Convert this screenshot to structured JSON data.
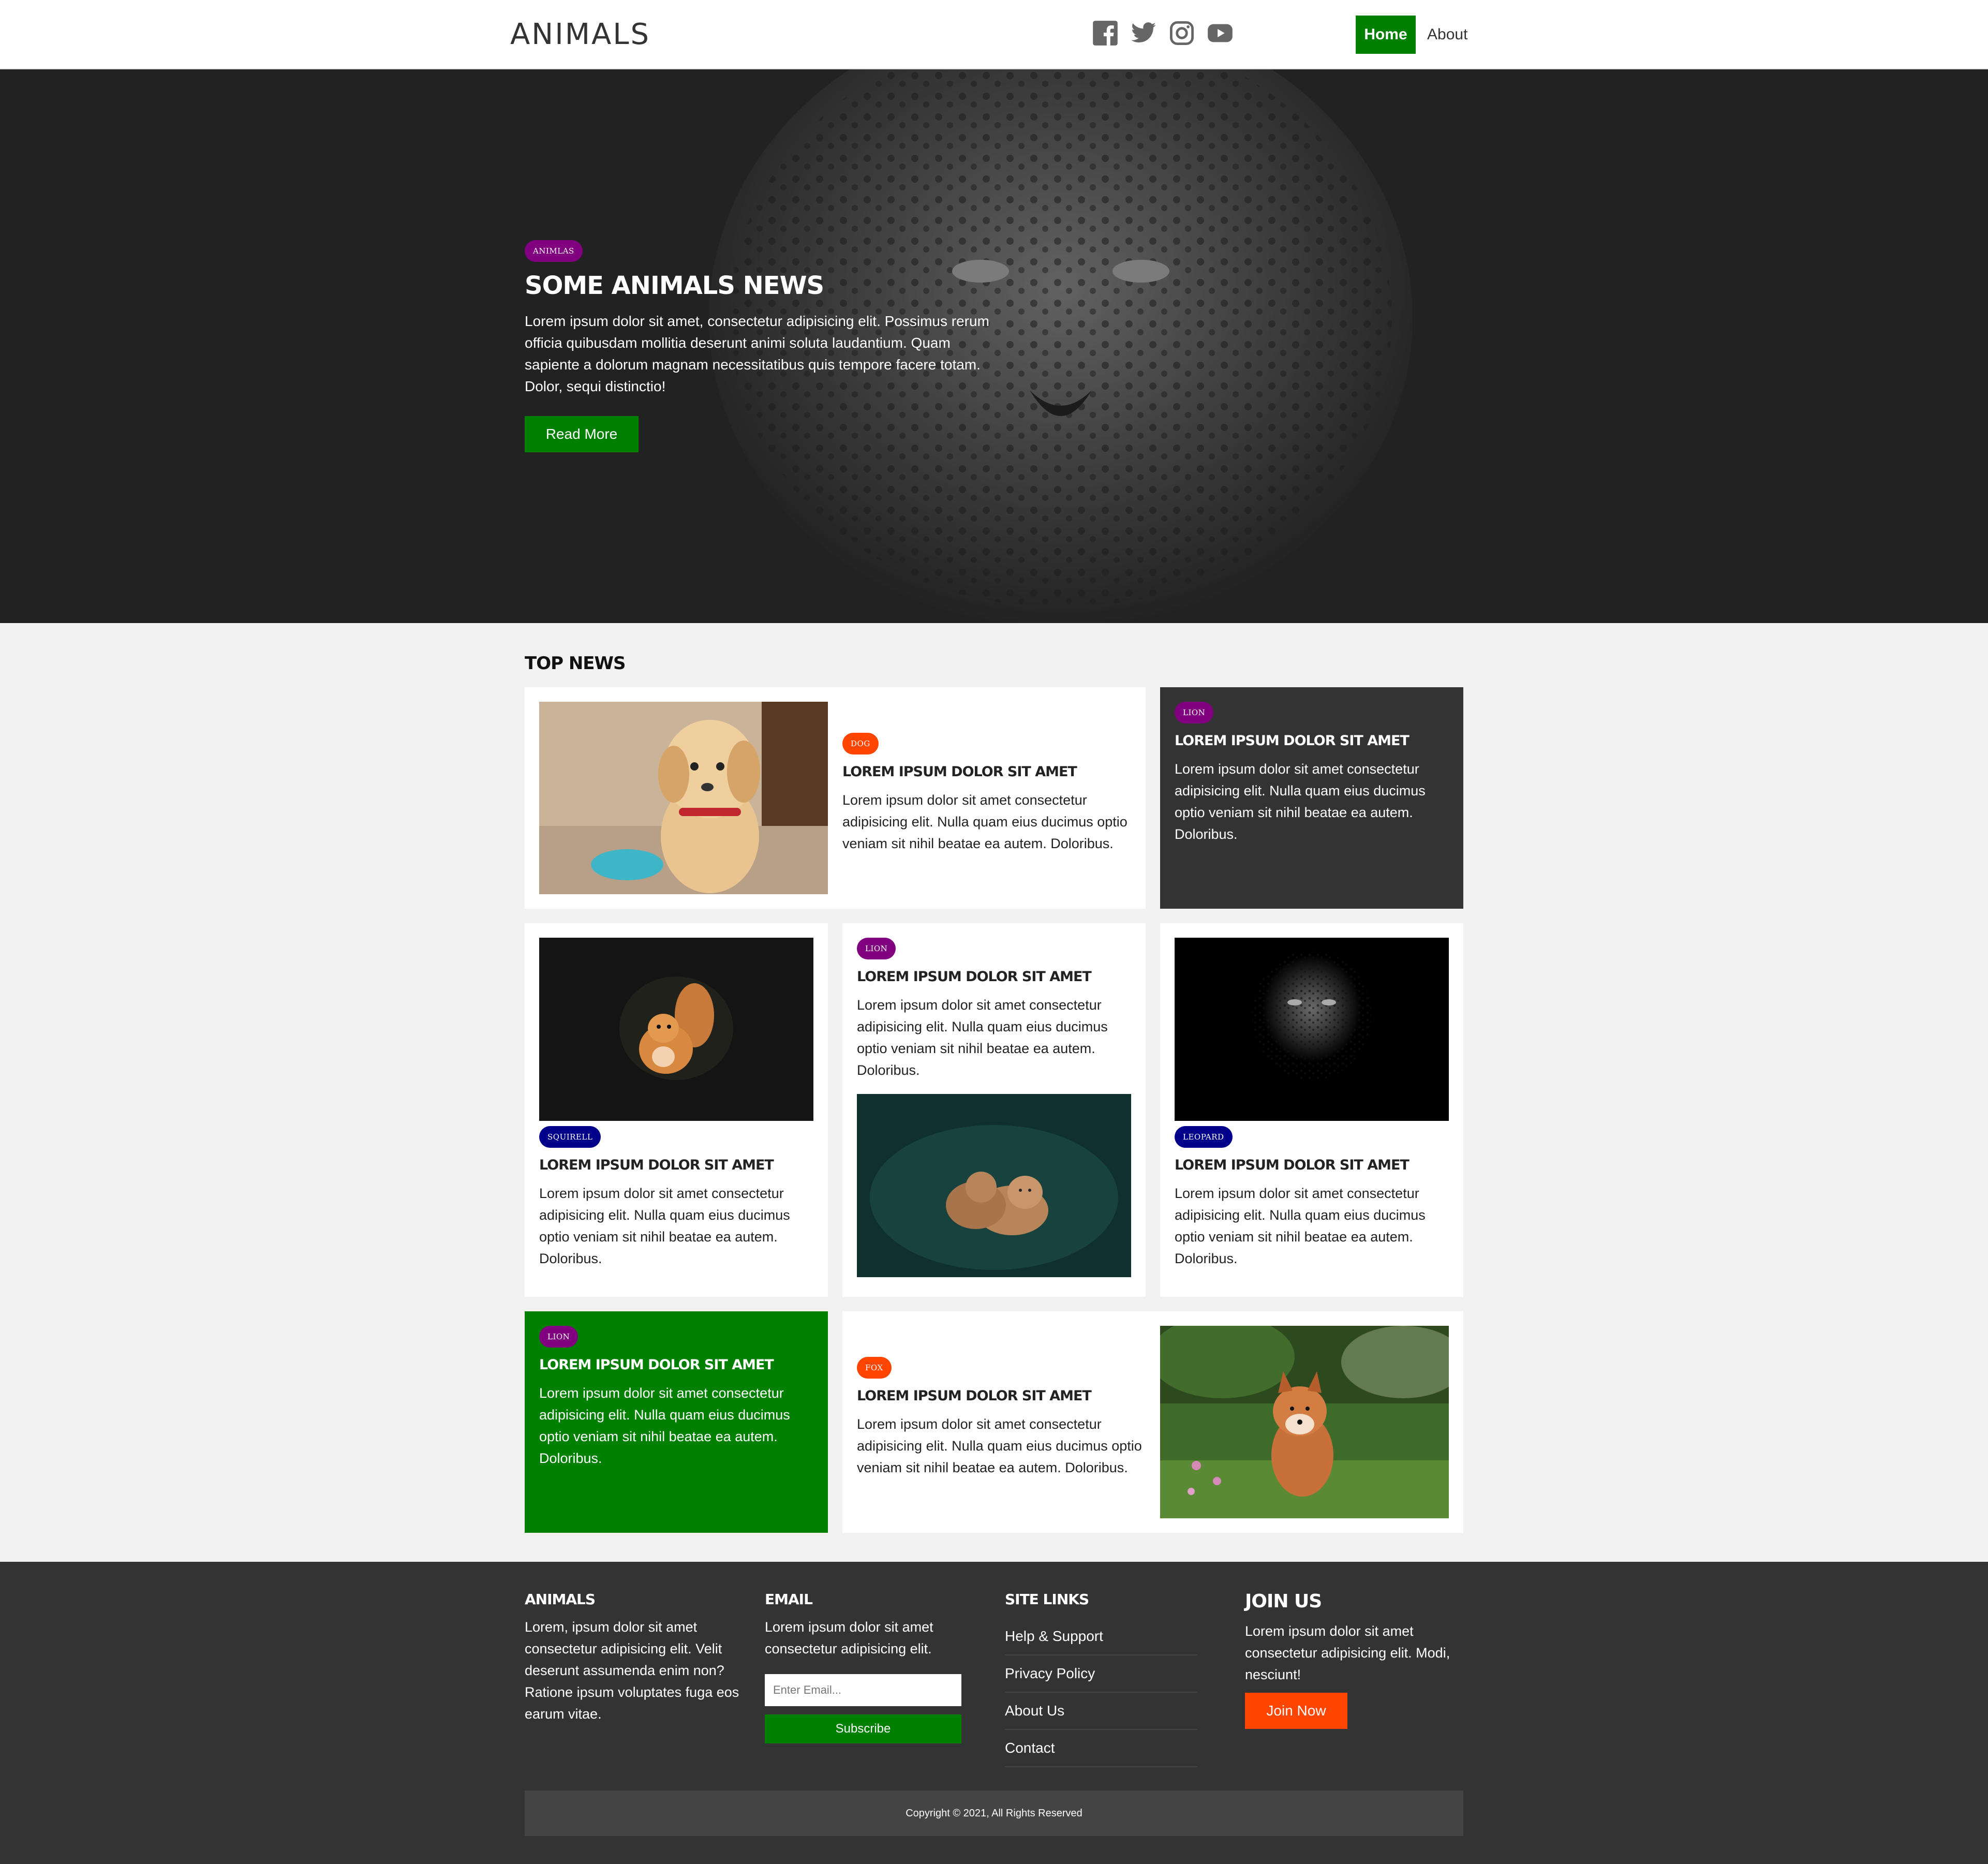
{
  "header": {
    "logo": "ANIMALS",
    "social_icons": [
      "facebook-icon",
      "twitter-icon",
      "instagram-icon",
      "youtube-icon"
    ],
    "nav": {
      "home": "Home",
      "about": "About"
    }
  },
  "hero": {
    "badge": "ANIMLAS",
    "title": "SOME ANIMALS NEWS",
    "text": "Lorem ipsum dolor sit amet, consectetur adipisicing elit. Possimus rerum officia quibusdam mollitia deserunt animi soluta laudantium. Quam sapiente a dolorum magnam necessitatibus quis tempore facere totam. Dolor, sequi distinctio!",
    "button": "Read More"
  },
  "top_news": {
    "title": "TOP NEWS",
    "cards": [
      {
        "badge": "DOG",
        "title": "LOREM IPSUM DOLOR SIT AMET",
        "text": "Lorem ipsum dolor sit amet consectetur adipisicing elit. Nulla quam eius ducimus optio veniam sit nihil beatae ea autem. Doloribus."
      },
      {
        "badge": "LION",
        "title": "LOREM IPSUM DOLOR SIT AMET",
        "text": "Lorem ipsum dolor sit amet consectetur adipisicing elit. Nulla quam eius ducimus optio veniam sit nihil beatae ea autem. Doloribus."
      },
      {
        "badge": "SQUIRELL",
        "title": "LOREM IPSUM DOLOR SIT AMET",
        "text": "Lorem ipsum dolor sit amet consectetur adipisicing elit. Nulla quam eius ducimus optio veniam sit nihil beatae ea autem. Doloribus."
      },
      {
        "badge": "LION",
        "title": "LOREM IPSUM DOLOR SIT AMET",
        "text": "Lorem ipsum dolor sit amet consectetur adipisicing elit. Nulla quam eius ducimus optio veniam sit nihil beatae ea autem. Doloribus."
      },
      {
        "badge": "LEOPARD",
        "title": "LOREM IPSUM DOLOR SIT AMET",
        "text": "Lorem ipsum dolor sit amet consectetur adipisicing elit. Nulla quam eius ducimus optio veniam sit nihil beatae ea autem. Doloribus."
      },
      {
        "badge": "LION",
        "title": "LOREM IPSUM DOLOR SIT AMET",
        "text": "Lorem ipsum dolor sit amet consectetur adipisicing elit. Nulla quam eius ducimus optio veniam sit nihil beatae ea autem. Doloribus."
      },
      {
        "badge": "FOX",
        "title": "LOREM IPSUM DOLOR SIT AMET",
        "text": "Lorem ipsum dolor sit amet consectetur adipisicing elit. Nulla quam eius ducimus optio veniam sit nihil beatae ea autem. Doloribus."
      }
    ]
  },
  "footer": {
    "about": {
      "title": "ANIMALS",
      "text": "Lorem, ipsum dolor sit amet consectetur adipisicing elit. Velit deserunt assumenda enim non? Ratione ipsum voluptates fuga eos earum vitae."
    },
    "email": {
      "title": "EMAIL",
      "text": "Lorem ipsum dolor sit amet consectetur adipisicing elit.",
      "placeholder": "Enter Email...",
      "button": "Subscribe"
    },
    "links": {
      "title": "SITE LINKS",
      "items": [
        "Help & Support",
        "Privacy Policy",
        "About Us",
        "Contact"
      ]
    },
    "join": {
      "title": "JOIN US",
      "text": "Lorem ipsum dolor sit amet consectetur adipisicing elit. Modi, nesciunt!",
      "button": "Join Now"
    },
    "copyright": "Copyright © 2021, All Rights Reserved"
  },
  "colors": {
    "accent_green": "#008000",
    "badge_purple": "#800080",
    "badge_orange": "#ff4500",
    "badge_navy": "#00008b",
    "dark": "#333333"
  }
}
